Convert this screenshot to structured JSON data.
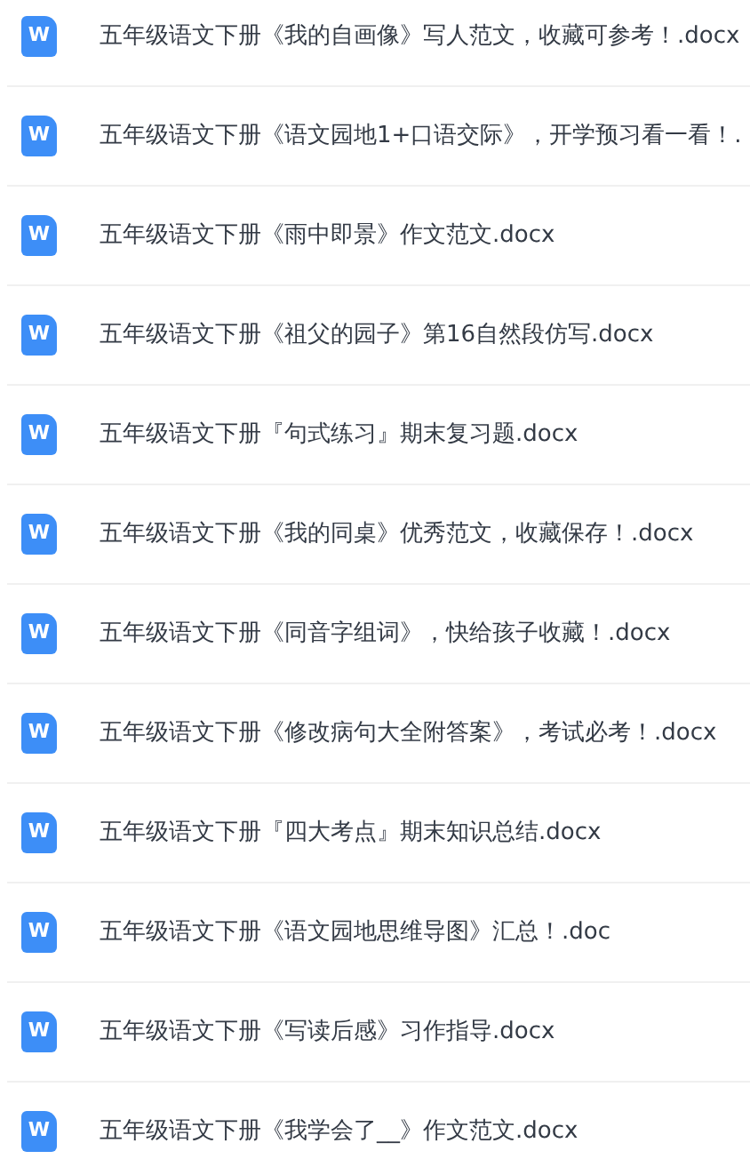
{
  "files": [
    {
      "icon_letter": "W",
      "name": "五年级语文下册《我的自画像》写人范文，收藏可参考！.docx"
    },
    {
      "icon_letter": "W",
      "name": "五年级语文下册《语文园地1+口语交际》，开学预习看一看！."
    },
    {
      "icon_letter": "W",
      "name": "五年级语文下册《雨中即景》作文范文.docx"
    },
    {
      "icon_letter": "W",
      "name": "五年级语文下册《祖父的园子》第16自然段仿写.docx"
    },
    {
      "icon_letter": "W",
      "name": "五年级语文下册『句式练习』期末复习题.docx"
    },
    {
      "icon_letter": "W",
      "name": "五年级语文下册《我的同桌》优秀范文，收藏保存！.docx"
    },
    {
      "icon_letter": "W",
      "name": "五年级语文下册《同音字组词》，快给孩子收藏！.docx"
    },
    {
      "icon_letter": "W",
      "name": "五年级语文下册《修改病句大全附答案》，考试必考！.docx"
    },
    {
      "icon_letter": "W",
      "name": "五年级语文下册『四大考点』期末知识总结.docx"
    },
    {
      "icon_letter": "W",
      "name": "五年级语文下册《语文园地思维导图》汇总！.doc"
    },
    {
      "icon_letter": "W",
      "name": "五年级语文下册《写读后感》习作指导.docx"
    },
    {
      "icon_letter": "W",
      "name": "五年级语文下册《我学会了__》作文范文.docx"
    }
  ]
}
